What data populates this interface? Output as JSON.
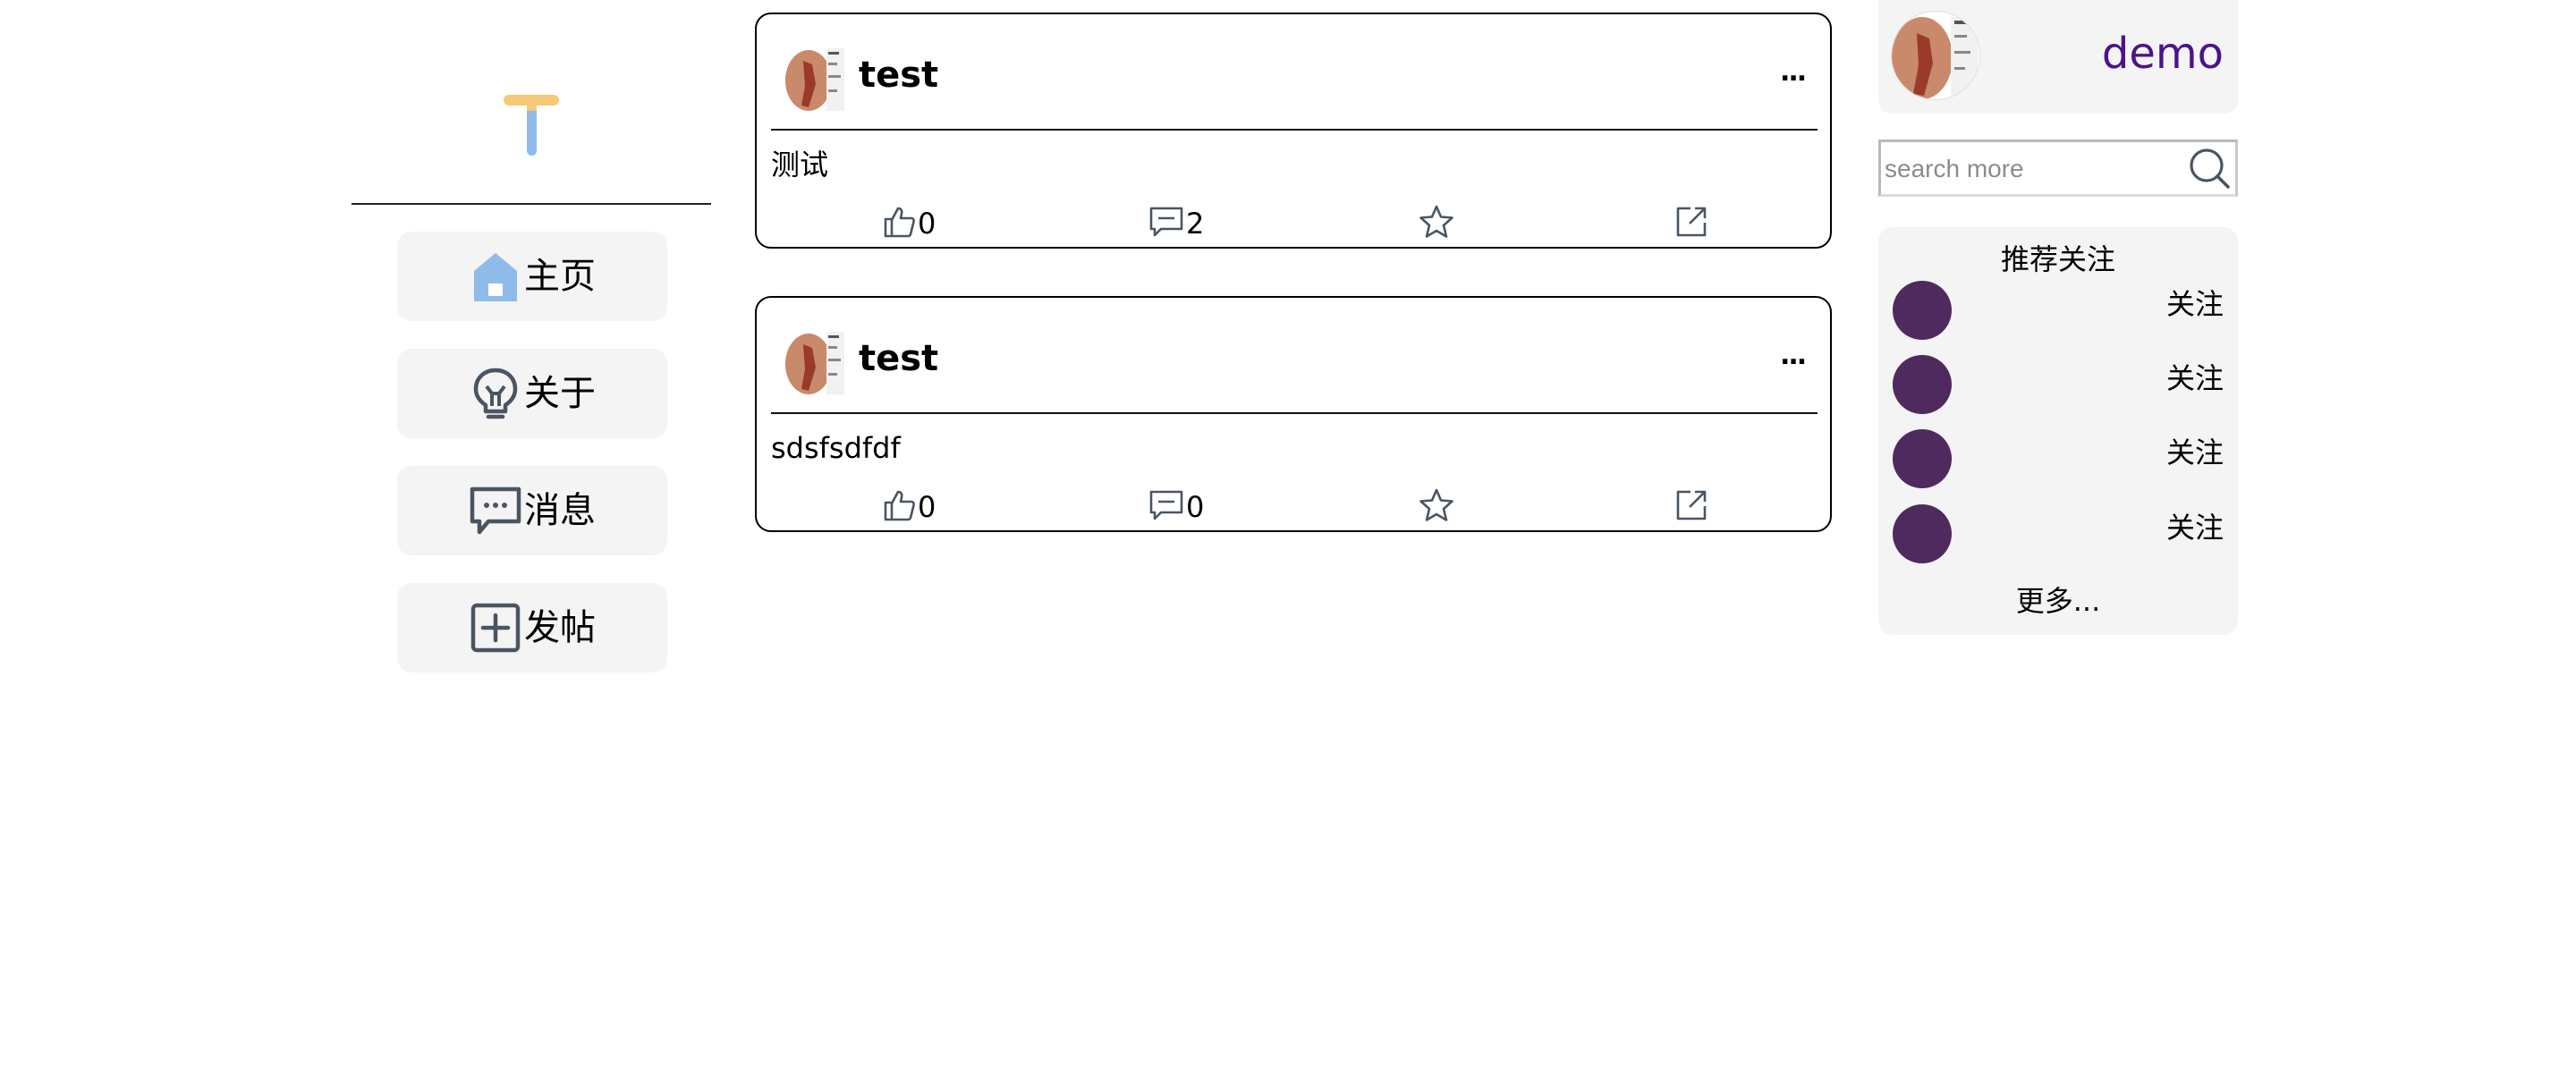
{
  "nav": {
    "items": [
      {
        "label": "主页",
        "icon": "home-icon"
      },
      {
        "label": "关于",
        "icon": "about-bulb-icon"
      },
      {
        "label": "消息",
        "icon": "message-icon"
      },
      {
        "label": "发帖",
        "icon": "new-post-icon"
      }
    ],
    "logo_colors": {
      "top": "#f6c877",
      "stem": "#8fbbea"
    }
  },
  "posts": [
    {
      "author": "test",
      "more": "...",
      "content": "测试",
      "likes": "0",
      "comments": "2"
    },
    {
      "author": "test",
      "more": "...",
      "content": "sdsfsdfdf",
      "likes": "0",
      "comments": "0"
    }
  ],
  "profile": {
    "name": "demo",
    "name_color": "#4a148c"
  },
  "search": {
    "placeholder": "search more"
  },
  "recommend": {
    "title": "推荐关注",
    "users": [
      {
        "follow": "关注"
      },
      {
        "follow": "关注"
      },
      {
        "follow": "关注"
      },
      {
        "follow": "关注"
      }
    ],
    "more": "更多...",
    "avatar_color": "#4e2a5e"
  }
}
